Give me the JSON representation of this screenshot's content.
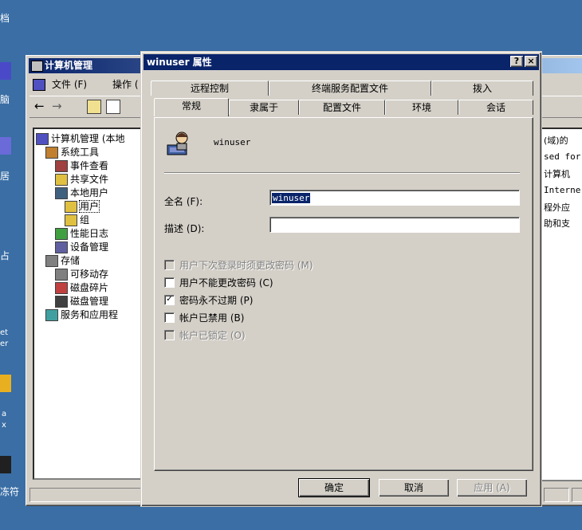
{
  "desktop": {
    "labels": [
      "档",
      "脑",
      "居",
      "占",
      "et",
      "er",
      "a",
      "x",
      "冻符"
    ]
  },
  "mgmt_window": {
    "title": "计算机管理",
    "menu": [
      "文件 (F)",
      "操作 ("
    ],
    "tree": [
      {
        "label": "计算机管理 (本地",
        "indent": 0
      },
      {
        "label": "系统工具",
        "indent": 1
      },
      {
        "label": "事件查看",
        "indent": 2
      },
      {
        "label": "共享文件",
        "indent": 2
      },
      {
        "label": "本地用户",
        "indent": 2
      },
      {
        "label": "用户",
        "indent": 3
      },
      {
        "label": "组",
        "indent": 3
      },
      {
        "label": "性能日志",
        "indent": 2
      },
      {
        "label": "设备管理",
        "indent": 2
      },
      {
        "label": "存储",
        "indent": 1
      },
      {
        "label": "可移动存",
        "indent": 2
      },
      {
        "label": "磁盘碎片",
        "indent": 2
      },
      {
        "label": "磁盘管理",
        "indent": 2
      },
      {
        "label": "服务和应用程",
        "indent": 1
      }
    ],
    "right_pane_lines": [
      "(域)的",
      "sed for",
      "计算机",
      "Interne",
      "程外应",
      "助和支"
    ]
  },
  "dialog": {
    "title": "winuser 属性",
    "help_btn": "?",
    "close_btn": "×",
    "tabs_row1": [
      "远程控制",
      "终端服务配置文件",
      "拨入"
    ],
    "tabs_row2": [
      "常规",
      "隶属于",
      "配置文件",
      "环境",
      "会话"
    ],
    "username": "winuser",
    "fullname_label": "全名 (F):",
    "fullname_value": "winuser",
    "desc_label": "描述 (D):",
    "desc_value": "",
    "checkboxes": [
      {
        "label": "用户下次登录时须更改密码 (M)",
        "checked": false,
        "disabled": true
      },
      {
        "label": "用户不能更改密码 (C)",
        "checked": false,
        "disabled": false
      },
      {
        "label": "密码永不过期 (P)",
        "checked": true,
        "disabled": false
      },
      {
        "label": "帐户已禁用 (B)",
        "checked": false,
        "disabled": false
      },
      {
        "label": "帐户已锁定 (O)",
        "checked": false,
        "disabled": true
      }
    ],
    "ok": "确定",
    "cancel": "取消",
    "apply": "应用 (A)"
  }
}
